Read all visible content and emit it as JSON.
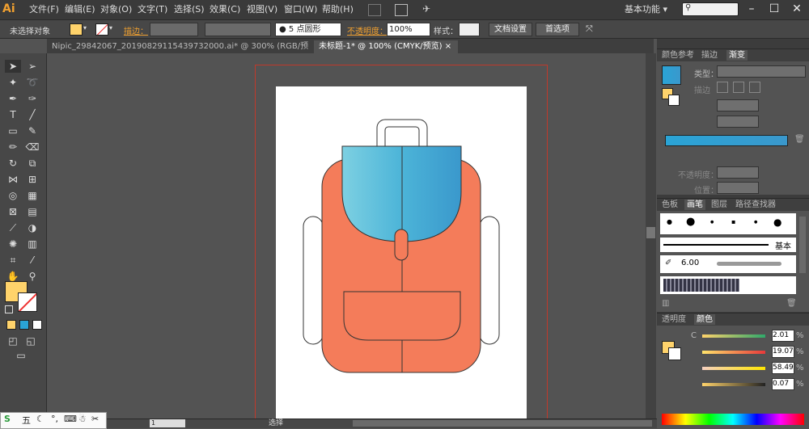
{
  "app": {
    "logo": "Ai"
  },
  "menu": {
    "items": [
      "文件(F)",
      "编辑(E)",
      "对象(O)",
      "文字(T)",
      "选择(S)",
      "效果(C)",
      "视图(V)",
      "窗口(W)",
      "帮助(H)"
    ],
    "workspace": "基本功能",
    "workspace_arrow": "▾"
  },
  "control": {
    "selection_status": "未选择对象",
    "stroke_label": "描边：",
    "brush_label": "5 点圆形",
    "opacity_label": "不透明度：",
    "opacity_value": "100%",
    "style_label": "样式：",
    "doc_setup": "文档设置",
    "preferences": "首选项"
  },
  "tabs": [
    {
      "label": "Nipic_29842067_20190829115439732000.ai* @ 300% (RGB/预览)",
      "close": "×"
    },
    {
      "label": "未标题-1* @ 100% (CMYK/预览)",
      "close": "×"
    }
  ],
  "status": {
    "zoom_prefix": "",
    "page": "1",
    "tool": "选择"
  },
  "panels": {
    "gradient": {
      "tabs": [
        "颜色参考",
        "描边",
        "渐变"
      ],
      "type_label": "类型：",
      "stroke_label": "描边",
      "opacity_label": "不透明度：",
      "position_label": "位置："
    },
    "brushes": {
      "tabs": [
        "色板",
        "画笔",
        "图层",
        "路径查找器"
      ],
      "basic_label": "基本",
      "size_value": "6.00"
    },
    "color": {
      "tabs": [
        "透明度",
        "颜色"
      ],
      "c_label": "C",
      "c_value": "2.01",
      "m_value": "19.07",
      "y_value": "58.49",
      "k_value": "0.07",
      "pct": "%"
    }
  },
  "ime": {
    "label": "五"
  },
  "colors": {
    "fill": "#ffd36b",
    "bag_body": "#f47c5a",
    "bag_flap_light": "#7dd0e2",
    "bag_flap_dark": "#3a98cc",
    "gradient_start": "#2aa4d6",
    "gradient_end": "#3a98cc"
  }
}
